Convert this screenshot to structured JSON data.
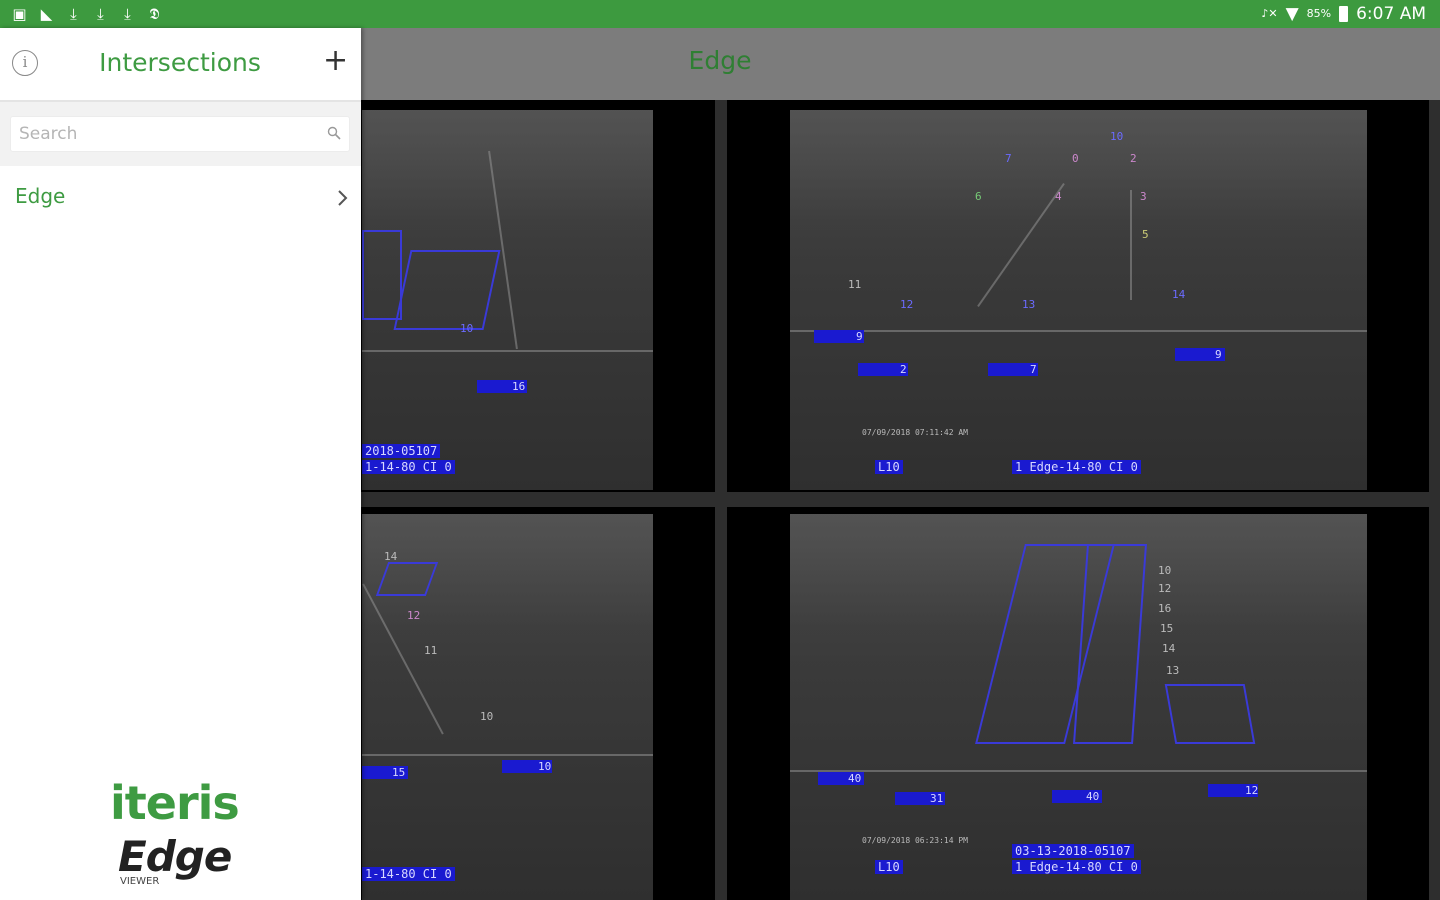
{
  "status_bar": {
    "notification_icons": [
      "image-icon",
      "flipboard-icon",
      "download-icon",
      "download-icon",
      "download-icon",
      "nyt-icon"
    ],
    "signal_text": "",
    "battery_percent": "85%",
    "time": "6:07 AM"
  },
  "drawer": {
    "title": "Intersections",
    "add_symbol": "+",
    "search_placeholder": "Search",
    "items": [
      {
        "label": "Edge"
      }
    ],
    "logo": {
      "brand": "iteris",
      "product": "Edge",
      "sub": "VIEWER"
    }
  },
  "main": {
    "title": "Edge",
    "cameras": [
      {
        "zones": [
          "10",
          "16"
        ],
        "osd_lines": [
          "2018-05107",
          "1-14-80 CI 0"
        ]
      },
      {
        "zones": [
          "10",
          "7",
          "0",
          "2",
          "6",
          "3",
          "4",
          "5",
          "11",
          "12",
          "13",
          "14",
          "9",
          "2",
          "7",
          "9"
        ],
        "osd_lines": [
          "L10",
          "1 Edge-14-80 CI 0"
        ],
        "date_stamp": "07/09/2018 07:11:42 AM"
      },
      {
        "zones": [
          "14",
          "12",
          "11",
          "10",
          "15",
          "10"
        ],
        "osd_lines": [
          "1-14-80 CI 0"
        ]
      },
      {
        "zones": [
          "10",
          "12",
          "16",
          "15",
          "14",
          "13",
          "40",
          "31",
          "40",
          "12"
        ],
        "osd_lines": [
          "L10",
          "03-13-2018-05107",
          "1 Edge-14-80 CI 0"
        ],
        "date_stamp": "07/09/2018 06:23:14 PM"
      }
    ]
  },
  "colors": {
    "status_bar": "#3d9a3f",
    "accent_green": "#3e9b42",
    "appbar_dim": "#7c7c7c",
    "detector_blue": "#1a1ad0"
  }
}
